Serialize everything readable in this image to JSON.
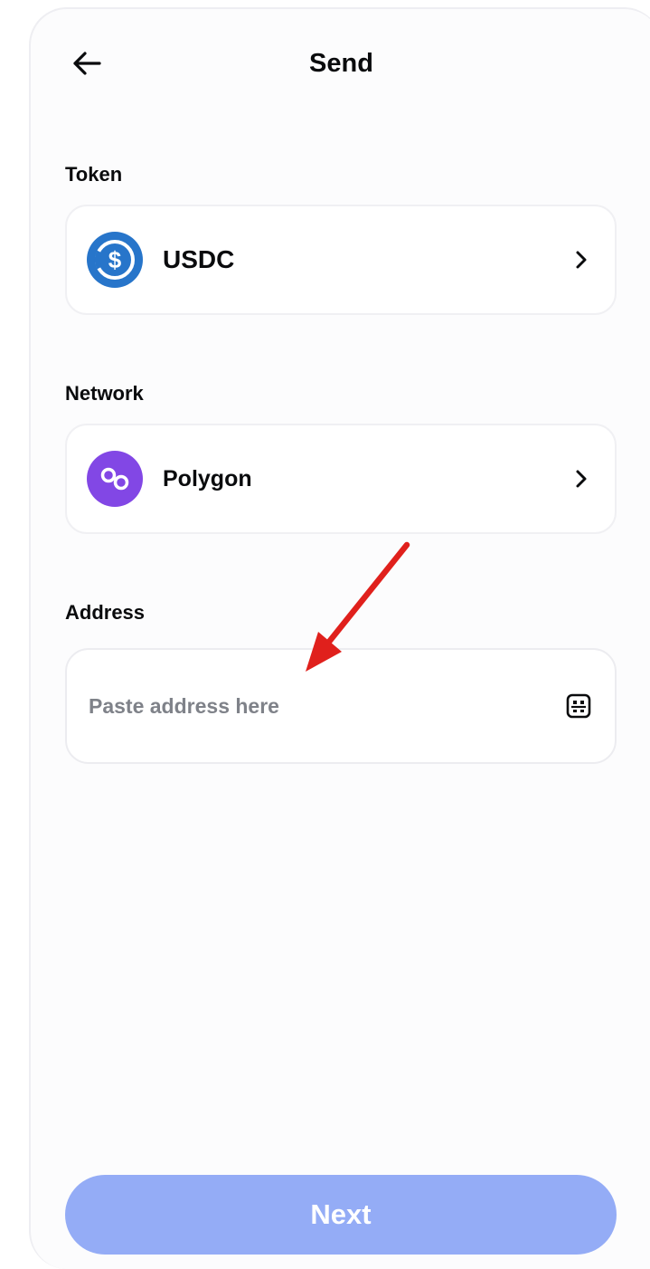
{
  "header": {
    "title": "Send",
    "back_icon": "arrow-left-icon"
  },
  "token": {
    "label": "Token",
    "value": "USDC",
    "icon": "usdc-icon",
    "icon_color": "#2775ca"
  },
  "network": {
    "label": "Network",
    "value": "Polygon",
    "icon": "polygon-icon",
    "icon_color": "#8247e5"
  },
  "address": {
    "label": "Address",
    "placeholder": "Paste address here",
    "value": "",
    "scan_icon": "qr-scan-icon"
  },
  "annotation": {
    "color": "#e0201c"
  },
  "footer": {
    "next_label": "Next",
    "next_color": "#94acf6"
  }
}
